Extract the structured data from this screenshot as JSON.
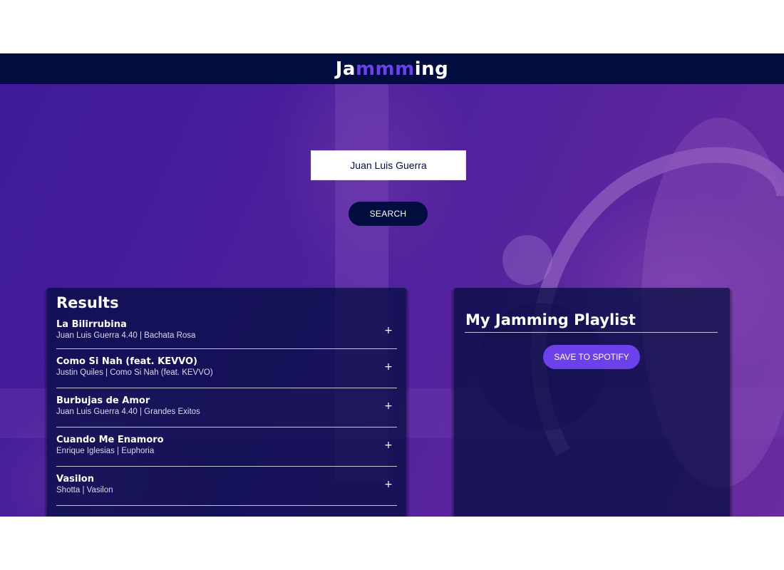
{
  "header": {
    "logo_prefix": "Ja",
    "logo_accent": "mmm",
    "logo_suffix": "ing"
  },
  "search": {
    "value": "Juan Luis Guerra",
    "button_label": "SEARCH"
  },
  "results": {
    "title": "Results",
    "tracks": [
      {
        "name": "La Bilirrubina",
        "meta": "Juan Luis Guerra 4.40 | Bachata Rosa",
        "action": "+"
      },
      {
        "name": "Como Si Nah (feat. KEVVO)",
        "meta": "Justin Quiles | Como Si Nah (feat. KEVVO)",
        "action": "+"
      },
      {
        "name": "Burbujas de Amor",
        "meta": "Juan Luis Guerra 4.40 | Grandes Exitos",
        "action": "+"
      },
      {
        "name": "Cuando Me Enamoro",
        "meta": "Enrique Iglesias | Euphoria",
        "action": "+"
      },
      {
        "name": "Vasilon",
        "meta": "Shotta | Vasilon",
        "action": "+"
      }
    ]
  },
  "playlist": {
    "name": "My Jamming Playlist",
    "save_label": "SAVE TO SPOTIFY"
  },
  "colors": {
    "header_bg": "#010c3f",
    "accent": "#6c41ec",
    "background": "#4a1f9c"
  }
}
